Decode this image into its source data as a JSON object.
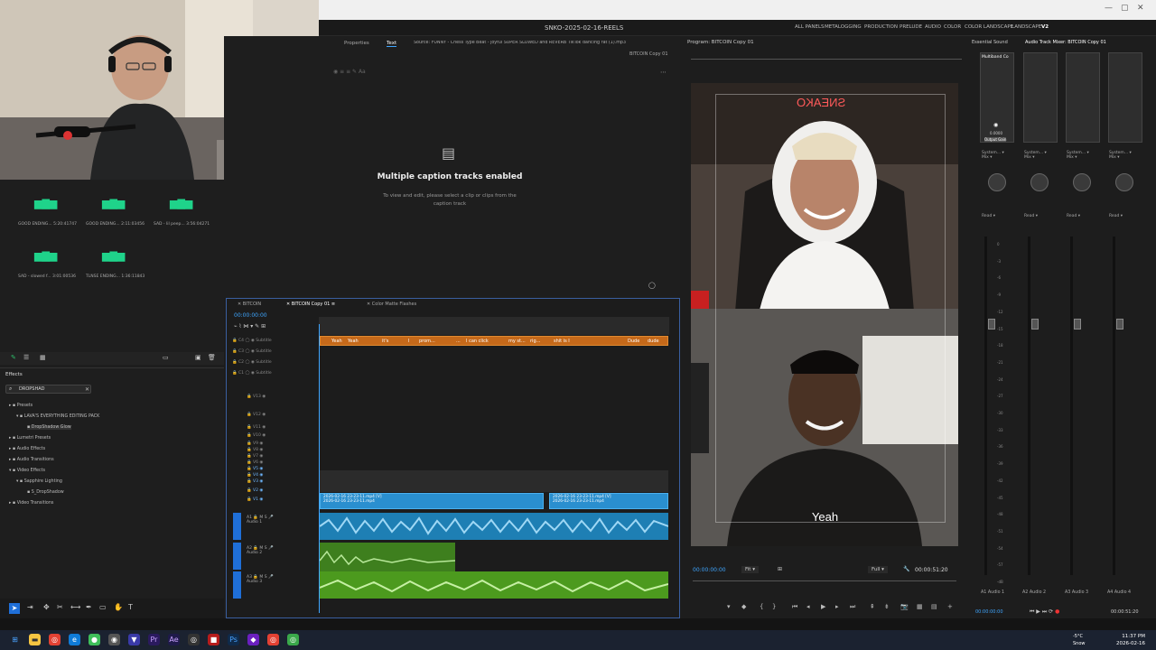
{
  "app": {
    "title": "SNKO-2025-02-16-REELS",
    "workspaces": [
      "ALL PANELS",
      "METALOGGING",
      "PRODUCTION",
      "PRELUDE",
      "AUDIO",
      "COLOR",
      "COLOR LANDSCAPE",
      "LANDSCAPE",
      "V2"
    ]
  },
  "project": {
    "bins": [
      {
        "label": "GOOD ENDING...",
        "duration": "5:20:41747"
      },
      {
        "label": "GOOD ENDING...",
        "duration": "2:11:03456"
      },
      {
        "label": "SAD - lil peep...",
        "duration": "3:56:04271"
      },
      {
        "label": "SAD - slowed f...",
        "duration": "3:01:00536"
      },
      {
        "label": "TLNSE ENDING...",
        "duration": "1:36:11843"
      }
    ]
  },
  "effects": {
    "panel_title": "Effects",
    "search_value": "DROPSHAD",
    "tree": [
      "Presets",
      "LAVA'S EVERYTHING EDITING PACK",
      "DropShadow Glow",
      "Lumetri Presets",
      "Audio Effects",
      "Audio Transitions",
      "Video Effects",
      "Sapphire Lighting",
      "S_DropShadow",
      "Video Transitions"
    ]
  },
  "text_panel": {
    "tabs": [
      "Properties",
      "Text"
    ],
    "source_label": "Source: FUNNY - Chess Type Beat - joyful  SUPER SLOWED and REVERB  TikTok dancing rat (1).mp3",
    "sequence_name": "BITCOIN Copy 01",
    "heading": "Multiple caption tracks enabled",
    "subtext": "To view and edit, please select a clip or clips from the caption track"
  },
  "timeline": {
    "tabs": [
      "BITCOIN",
      "BITCOIN Copy 01",
      "Color Matte Flashes"
    ],
    "timecode": "00:00:00:00",
    "subtitle_tracks": [
      "Subtitle",
      "Subtitle",
      "Subtitle",
      "Subtitle"
    ],
    "video_tracks": [
      "V13",
      "V12",
      "V11",
      "V10",
      "V9",
      "V8",
      "V7",
      "V6",
      "V5",
      "V4",
      "V3",
      "V2",
      "V1"
    ],
    "audio_tracks": [
      "Audio 1",
      "Audio 2",
      "Audio 3"
    ],
    "caption_words": [
      "Yeah",
      "Yeah",
      "it's",
      "I",
      "prom...",
      "...",
      "I can click",
      "my st...",
      "rig...",
      "shit  is I",
      "Dude",
      "dude"
    ],
    "video_clips": [
      "2026-02-16 23-23-11.mp4 [V]",
      "2026-02-16 23-23-11.mp4",
      "2026-02-16 23-23-11.mp4 [V]",
      "2026-02-16 23-23-11.mp4"
    ]
  },
  "program": {
    "title": "Program: BITCOIN Copy 01",
    "caption": "Yeah",
    "neon_sign": "SNEAKO",
    "timecode": "00:00:00:00",
    "fit": "Fit",
    "quality": "Full",
    "duration": "00:00:51:20"
  },
  "mixer": {
    "tabs": [
      "Essential Sound",
      "Audio Track Mixer: BITCOIN Copy 01"
    ],
    "fx_label": "Multiband Co",
    "output_gain": "Output Gain",
    "gain_value": "0.0000",
    "channels": [
      {
        "input": "System...",
        "mode": "Mix",
        "automation": "Read",
        "name": "Audio 1",
        "track": "A1"
      },
      {
        "input": "System...",
        "mode": "Mix",
        "automation": "Read",
        "name": "Audio 2",
        "track": "A2"
      },
      {
        "input": "System...",
        "mode": "Mix",
        "automation": "Read",
        "name": "Audio 3",
        "track": "A3"
      },
      {
        "input": "System...",
        "mode": "Mix",
        "automation": "Read",
        "name": "Audio 4",
        "track": "A4"
      }
    ],
    "scale": [
      "0",
      "-3",
      "-6",
      "-9",
      "-12",
      "-15",
      "-18",
      "-21",
      "-24",
      "-27",
      "-30",
      "-33",
      "-36",
      "-39",
      "-42",
      "-45",
      "-48",
      "-51",
      "-54",
      "-57",
      "-dB"
    ],
    "timecode": "00:00:00:00",
    "end_timecode": "00:00:51:20"
  },
  "taskbar": {
    "weather_temp": "-5°C",
    "weather_desc": "Snow",
    "time": "11:37 PM",
    "date": "2026-02-16"
  },
  "colors": {
    "accent": "#3fa6ff",
    "caption_clip": "#c5691a",
    "video_clip": "#2a8fcf",
    "audio_clip": "#4c9a1e"
  }
}
